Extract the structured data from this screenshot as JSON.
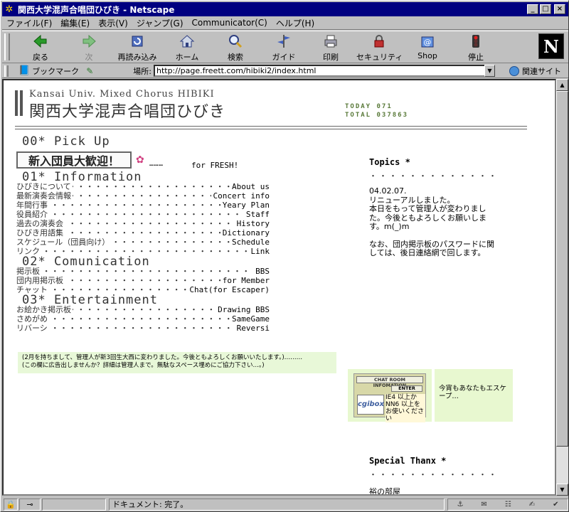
{
  "window": {
    "title": "関西大学混声合唱団ひびき - Netscape",
    "app_icon": "netscape-app-icon",
    "minimize_label": "_",
    "maximize_label": "□",
    "close_label": "×"
  },
  "menubar": {
    "items": [
      "ファイル(F)",
      "編集(E)",
      "表示(V)",
      "ジャンプ(G)",
      "Communicator(C)",
      "ヘルプ(H)"
    ]
  },
  "toolbar": {
    "buttons": [
      {
        "label": "戻る",
        "icon": "back-arrow-icon",
        "enabled": true
      },
      {
        "label": "次",
        "icon": "forward-arrow-icon",
        "enabled": false
      },
      {
        "label": "再読み込み",
        "icon": "reload-icon",
        "enabled": true
      },
      {
        "label": "ホーム",
        "icon": "home-icon",
        "enabled": true
      },
      {
        "label": "検索",
        "icon": "search-icon",
        "enabled": true
      },
      {
        "label": "ガイド",
        "icon": "guide-icon",
        "enabled": true
      },
      {
        "label": "印刷",
        "icon": "print-icon",
        "enabled": true
      },
      {
        "label": "セキュリティ",
        "icon": "security-lock-icon",
        "enabled": true
      },
      {
        "label": "Shop",
        "icon": "shop-icon",
        "enabled": true
      },
      {
        "label": "停止",
        "icon": "stop-icon",
        "enabled": true
      }
    ],
    "logo_letter": "N"
  },
  "locationbar": {
    "bookmark_label": "ブックマーク",
    "location_label": "場所:",
    "url": "http://page.freett.com/hibiki2/index.html",
    "related_label": "関連サイト"
  },
  "page": {
    "site_title_en": "Kansai Univ. Mixed Chorus HIBIKI",
    "site_title_jp": "関西大学混声合唱団ひびき",
    "counter_today": "TODAY 071",
    "counter_total": "TOTAL 037863",
    "sections": {
      "pickup": "00* Pick Up",
      "information": "01* Information",
      "communication": "02* Comunication",
      "entertainment": "03* Entertainment"
    },
    "welcome_banner": "新入団員大歓迎！",
    "fresh_dots": "………",
    "fresh_link": "for FRESH!",
    "dots_fill": "・・・・・・・・・・・・・・・・・・・・・・・・・・・・・・・・・・・・・・・・・・",
    "info_links": [
      {
        "jp": "ひびきについて",
        "en": "About us"
      },
      {
        "jp": "最新演奏会情報",
        "en": "Concert info"
      },
      {
        "jp": "年間行事",
        "en": "Yeary Plan"
      },
      {
        "jp": "役員紹介",
        "en": "Staff"
      },
      {
        "jp": "過去の演奏会",
        "en": "History"
      },
      {
        "jp": "ひびき用語集",
        "en": "Dictionary"
      },
      {
        "jp": "スケジュール（団員向け）",
        "en": "Schedule"
      },
      {
        "jp": "リンク",
        "en": "Link"
      }
    ],
    "comm_links": [
      {
        "jp": "掲示板",
        "en": "BBS"
      },
      {
        "jp": "団内用掲示板",
        "en": "for Member"
      },
      {
        "jp": "チャット",
        "en": "Chat(for Escaper)"
      }
    ],
    "ent_links": [
      {
        "jp": "お絵かき掲示板",
        "en": "Drawing BBS"
      },
      {
        "jp": "さめがめ",
        "en": "SameGame"
      },
      {
        "jp": "リバーシ",
        "en": "Reversi"
      }
    ],
    "notice_line1": "(2月を持ちまして、管理人が新3回生大西に変わりました。今後ともよろしくお願いいたします。)………",
    "notice_line2": "(この欄に広告出しませんか？詳細は管理人まで。無駄なスペース埋めにご協力下さい…。)",
    "topics": {
      "title": "Topics *",
      "dots": "・・・・・・・・・・・・・",
      "date": "04.02.07.",
      "line1": "リニューアルしました。",
      "line2": "本日をもって管理人が変わりました。今後ともよろしくお願いします。m(_)m",
      "line3": "なお、団内掲示板のパスワードに関しては、後日連絡網で回します。"
    },
    "chat_banner": {
      "header": "CHAT ROOM INFOMATION",
      "enter": "ENTER",
      "logo": "cgibox",
      "requirement": "IE4 以上か NN6 以上を お使いください"
    },
    "escaper_text": "今宵もあなたもエスケープ…",
    "thanx": {
      "title": "Special Thanx *",
      "dots": "・・・・・・・・・・・・・",
      "item1": "裕の部屋"
    }
  },
  "statusbar": {
    "status": "ドキュメント: 完了。"
  }
}
